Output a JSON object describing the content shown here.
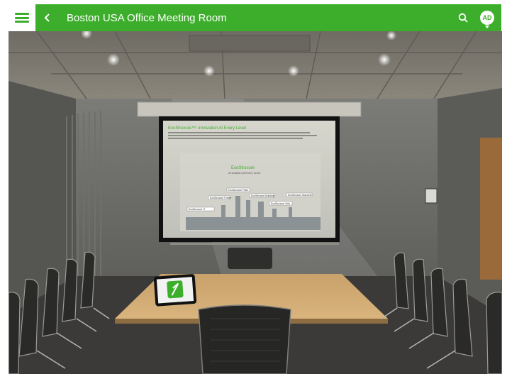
{
  "header": {
    "title": "Boston USA Office Meeting Room",
    "avatar_initials": "AD",
    "accent_color": "#3dae2b",
    "icons": {
      "menu": "hamburger-menu-icon",
      "back": "chevron-left-icon",
      "search": "search-icon"
    }
  },
  "scene": {
    "screen_title": "EcoStruxure™: Innovation At Every Level",
    "screen_logo": "EcoStruxure",
    "screen_logo_tagline": "Innovation At Every Level",
    "screen_labels": [
      "EcoStruxure Plant",
      "EcoStruxure Power",
      "EcoStruxure Building",
      "EcoStruxure Machine",
      "EcoStruxure Grid",
      "EcoStruxure IT"
    ]
  }
}
